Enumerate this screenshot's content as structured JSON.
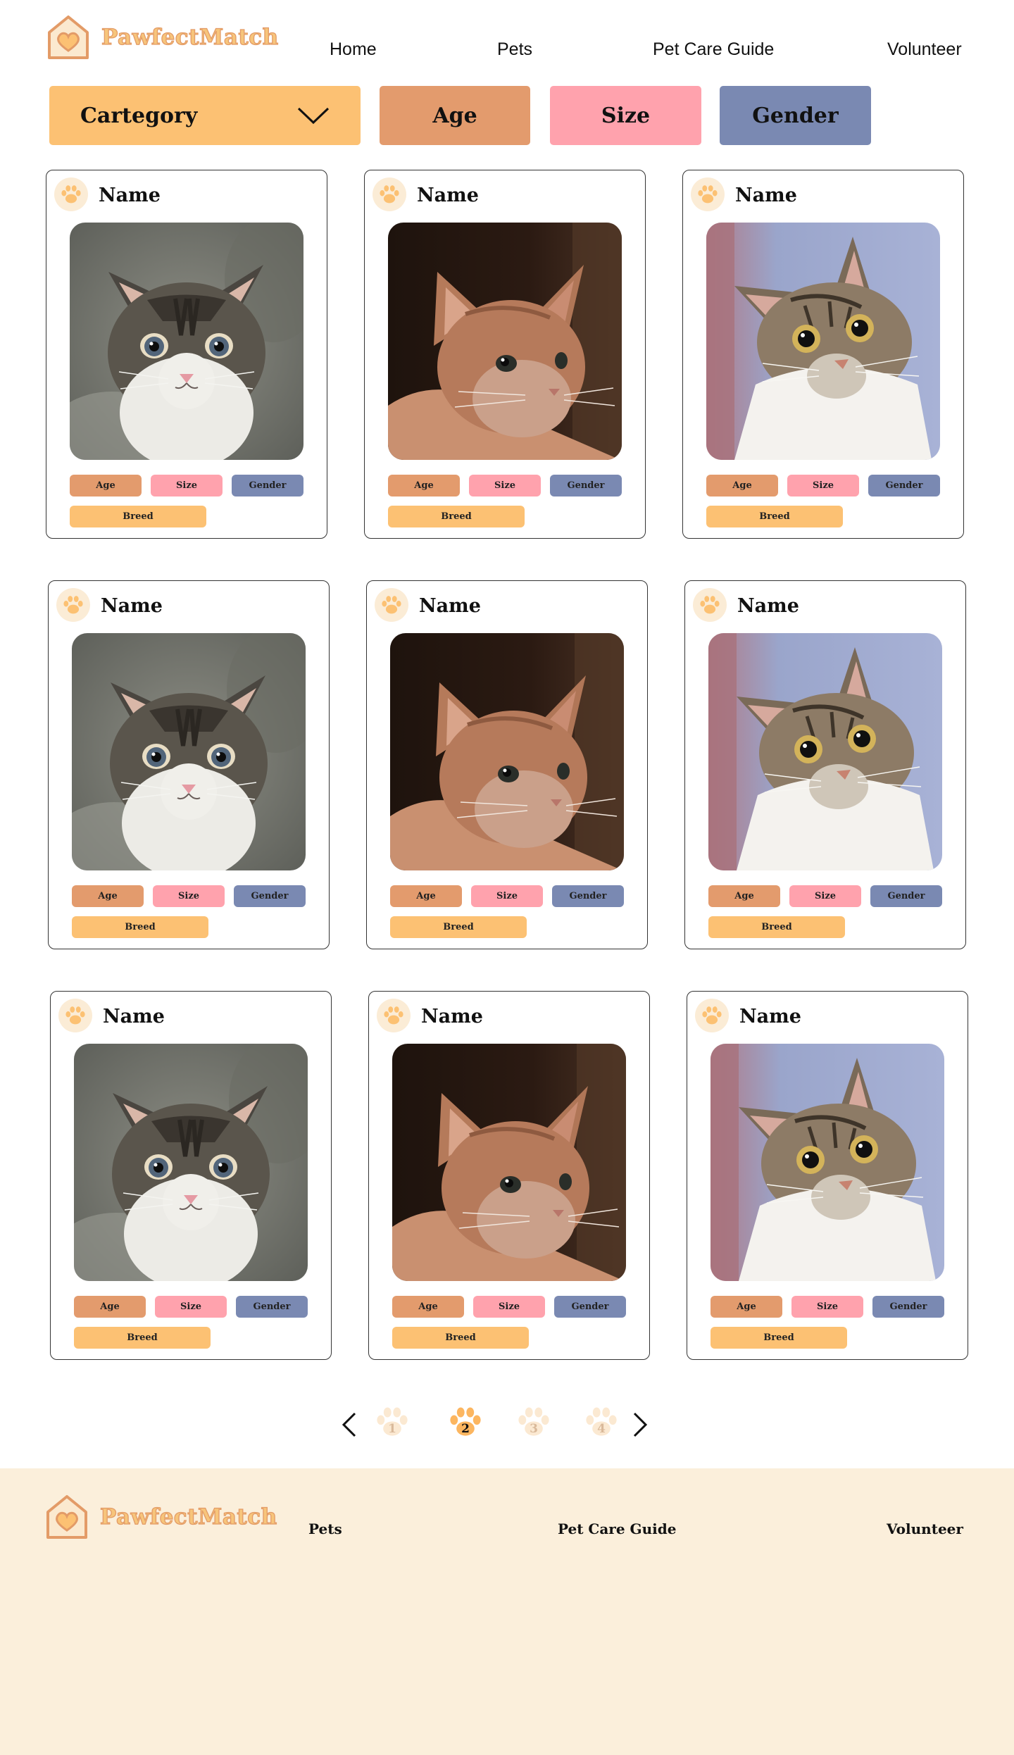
{
  "brand": {
    "name": "PawfectMatch",
    "primary": "#fcc173",
    "outline": "#e39b67"
  },
  "nav": [
    {
      "label": "Home"
    },
    {
      "label": "Pets"
    },
    {
      "label": "Pet Care Guide"
    },
    {
      "label": "Volunteer"
    }
  ],
  "filters": {
    "category": {
      "label": "Cartegory",
      "icon": "chevron-down-icon",
      "color": "#fcc173"
    },
    "age": {
      "label": "Age",
      "color": "#e39b6d"
    },
    "size": {
      "label": "Size",
      "color": "#ffa2ad"
    },
    "gender": {
      "label": "Gender",
      "color": "#7a89b2"
    }
  },
  "pets": [
    {
      "name": "Name",
      "photo": "tabby-kitten",
      "tags": {
        "age": "Age",
        "size": "Size",
        "gender": "Gender",
        "breed": "Breed"
      }
    },
    {
      "name": "Name",
      "photo": "orange-kitten",
      "tags": {
        "age": "Age",
        "size": "Size",
        "gender": "Gender",
        "breed": "Breed"
      }
    },
    {
      "name": "Name",
      "photo": "tabby-white-cat",
      "tags": {
        "age": "Age",
        "size": "Size",
        "gender": "Gender",
        "breed": "Breed"
      }
    },
    {
      "name": "Name",
      "photo": "tabby-kitten",
      "tags": {
        "age": "Age",
        "size": "Size",
        "gender": "Gender",
        "breed": "Breed"
      }
    },
    {
      "name": "Name",
      "photo": "orange-kitten",
      "tags": {
        "age": "Age",
        "size": "Size",
        "gender": "Gender",
        "breed": "Breed"
      }
    },
    {
      "name": "Name",
      "photo": "tabby-white-cat",
      "tags": {
        "age": "Age",
        "size": "Size",
        "gender": "Gender",
        "breed": "Breed"
      }
    },
    {
      "name": "Name",
      "photo": "tabby-kitten",
      "tags": {
        "age": "Age",
        "size": "Size",
        "gender": "Gender",
        "breed": "Breed"
      }
    },
    {
      "name": "Name",
      "photo": "orange-kitten",
      "tags": {
        "age": "Age",
        "size": "Size",
        "gender": "Gender",
        "breed": "Breed"
      }
    },
    {
      "name": "Name",
      "photo": "tabby-white-cat",
      "tags": {
        "age": "Age",
        "size": "Size",
        "gender": "Gender",
        "breed": "Breed"
      }
    }
  ],
  "pagination": {
    "prev_icon": "chevron-left-icon",
    "next_icon": "chevron-right-icon",
    "pages": [
      "1",
      "2",
      "3",
      "4"
    ],
    "current": "2"
  },
  "footer": {
    "links": [
      {
        "label": "Pets"
      },
      {
        "label": "Pet Care Guide"
      },
      {
        "label": "Volunteer"
      }
    ]
  }
}
